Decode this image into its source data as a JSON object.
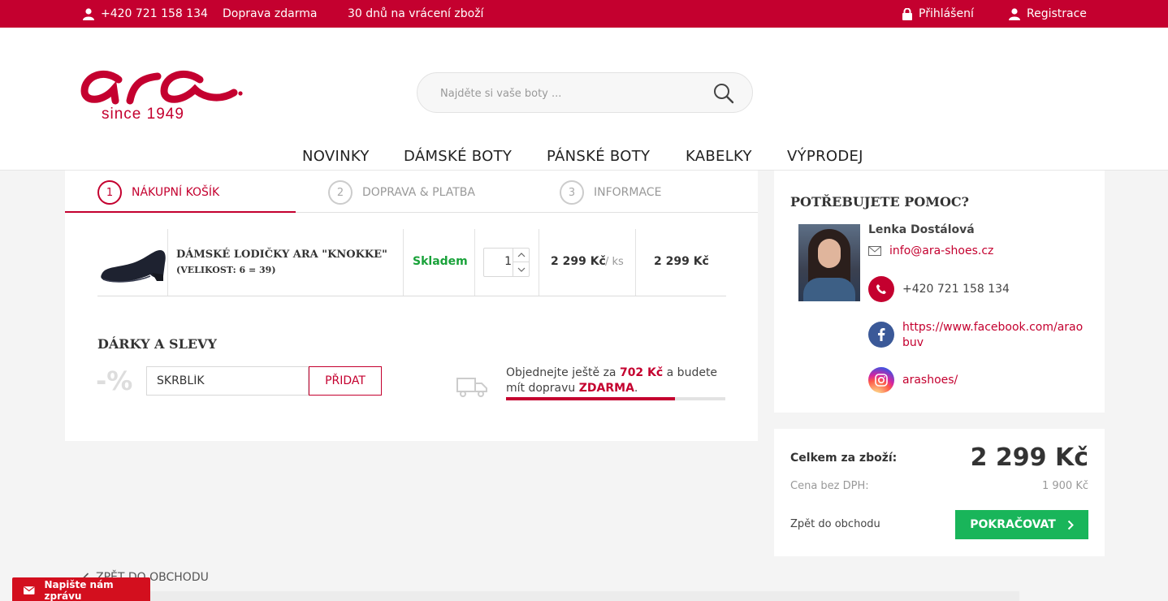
{
  "topbar": {
    "phone": "+420 721 158 134",
    "shipping": "Doprava zdarma",
    "returns": "30 dnů na vrácení zboží",
    "login": "Přihlášení",
    "register": "Registrace"
  },
  "logo": {
    "brand": "ara",
    "tagline": "since 1949"
  },
  "search": {
    "placeholder": "Najděte si vaše boty ..."
  },
  "nav": [
    "NOVINKY",
    "DÁMSKÉ BOTY",
    "PÁNSKÉ BOTY",
    "KABELKY",
    "VÝPRODEJ"
  ],
  "steps": [
    {
      "num": "1",
      "label": "NÁKUPNÍ KOŠÍK"
    },
    {
      "num": "2",
      "label": "DOPRAVA & PLATBA"
    },
    {
      "num": "3",
      "label": "INFORMACE"
    }
  ],
  "product": {
    "name": "DÁMSKÉ LODIČKY ARA \"KNOKKE\"",
    "size": "(VELIKOST: 6 = 39)",
    "stock": "Skladem",
    "qty": "1",
    "unit_price": "2 299 Kč",
    "unit": "/ ks",
    "total": "2 299 Kč"
  },
  "gifts": {
    "title": "DÁRKY A SLEVY",
    "percent_sign": "-%",
    "code_value": "SKRBLÍK",
    "add_label": "PŘIDAT"
  },
  "shipping_msg": {
    "prefix": "Objednejte ještě za ",
    "amount": "702 Kč",
    "middle": " a budete mít dopravu ",
    "free": "ZDARMA",
    "suffix": ".",
    "progress": 0.77
  },
  "help": {
    "title": "POTŘEBUJETE POMOC?",
    "name": "Lenka Dostálová",
    "email": "info@ara-shoes.cz",
    "phone": "+420 721 158 134",
    "facebook": "https://www.facebook.com/araobuv",
    "instagram": "arashoes/"
  },
  "summary": {
    "total_label": "Celkem za zboží:",
    "total_value": "2 299 Kč",
    "net_label": "Cena bez DPH:",
    "net_value": "1 900 Kč",
    "back_label": "Zpět do obchodu",
    "continue_label": "POKRAČOVAT"
  },
  "back_link": "ZPĚT DO OBCHODU",
  "chat": "Napište nám zprávu",
  "colors": {
    "brand": "#c4002f",
    "success": "#1aa23a",
    "button_green": "#19b55a"
  }
}
